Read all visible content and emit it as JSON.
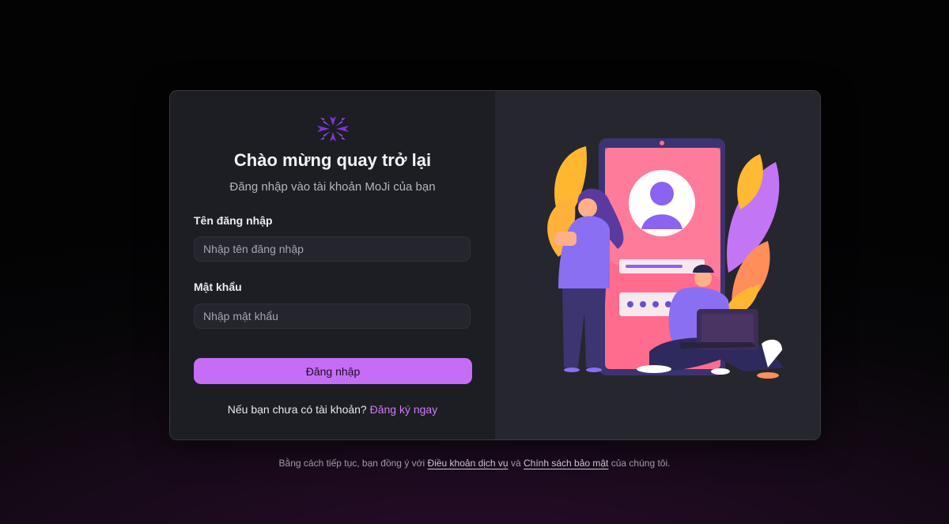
{
  "login": {
    "title": "Chào mừng quay trở lại",
    "subtitle": "Đăng nhập vào tài khoản MoJi của bạn",
    "username_label": "Tên đăng nhập",
    "username_placeholder": "Nhập tên đăng nhập",
    "username_value": "",
    "password_label": "Mật khẩu",
    "password_placeholder": "Nhập mật khẩu",
    "password_value": "",
    "submit_label": "Đăng nhập",
    "signup_prompt": "Nếu bạn chưa có tài khoản?",
    "signup_link": "Đăng ký ngay"
  },
  "footer": {
    "prefix": "Bằng cách tiếp tục, bạn đồng ý với",
    "terms_link": "Điều khoản dịch vụ",
    "and": "và",
    "privacy_link": "Chính sách bảo mật",
    "suffix": "của chúng tôi."
  },
  "icons": {
    "logo": "moji-logo-icon",
    "illustration": "login-illustration"
  },
  "colors": {
    "accent": "#c56df5",
    "link": "#d07cf7",
    "card_bg": "#1d1d24",
    "panel_bg": "#26262e"
  }
}
